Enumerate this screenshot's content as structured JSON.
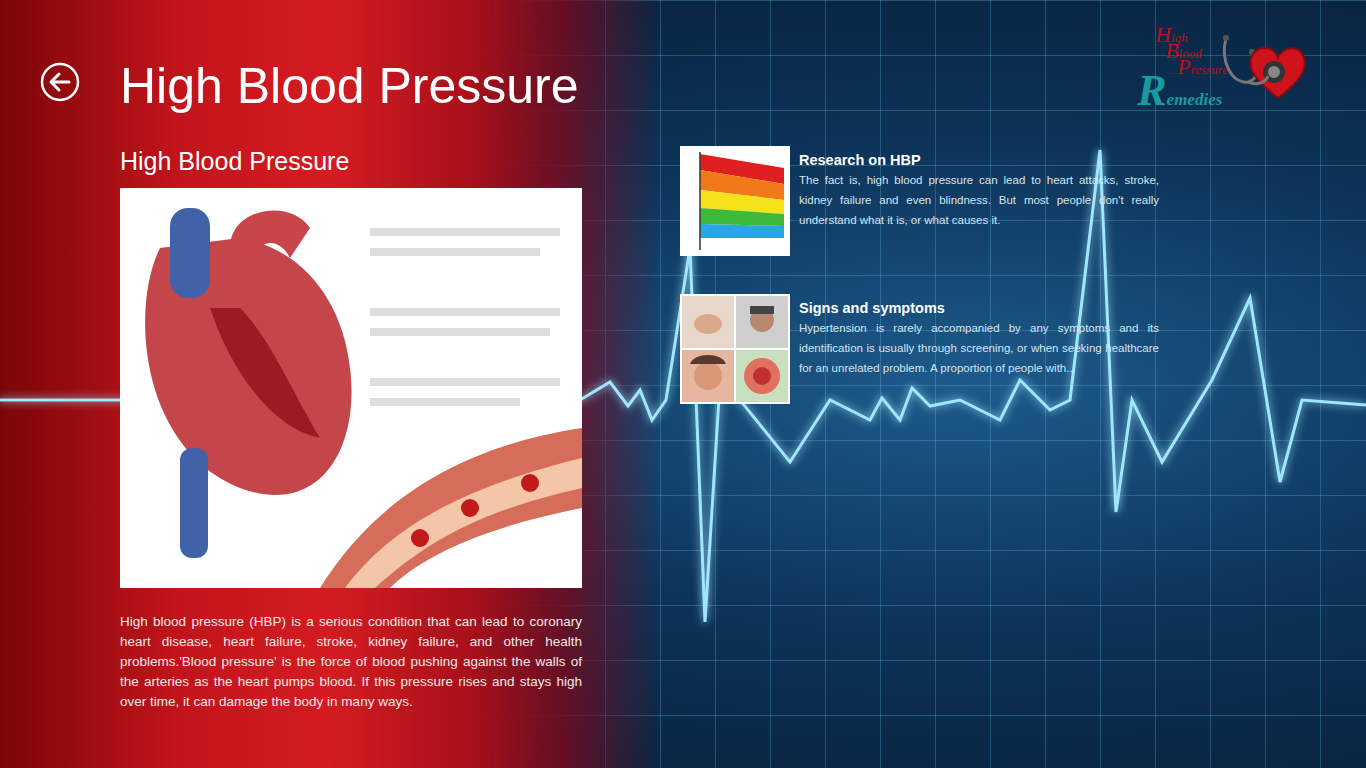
{
  "header": {
    "title": "High Blood Pressure"
  },
  "logo": {
    "lines": [
      "High",
      "Blood",
      "Pressure"
    ],
    "name": "Remedies"
  },
  "article": {
    "heading": "High Blood Pressure",
    "body": "High blood pressure (HBP) is a serious condition that can lead to coronary heart disease, heart failure, stroke, kidney failure, and other health problems.'Blood pressure' is the force of blood pushing against the walls of the arteries as the heart pumps blood. If this pressure rises and stays high over time, it can damage the body in many ways."
  },
  "items": [
    {
      "title": "Research on HBP",
      "description": "The fact is, high blood pressure can lead to heart attacks, stroke, kidney failure and even blindness. But most people don't really understand what it is, or what causes it."
    },
    {
      "title": "Signs and symptoms",
      "description": "Hypertension is rarely accompanied by any symptoms and its identification is usually through screening, or when seeking healthcare for an unrelated problem. A proportion of people with..."
    }
  ]
}
